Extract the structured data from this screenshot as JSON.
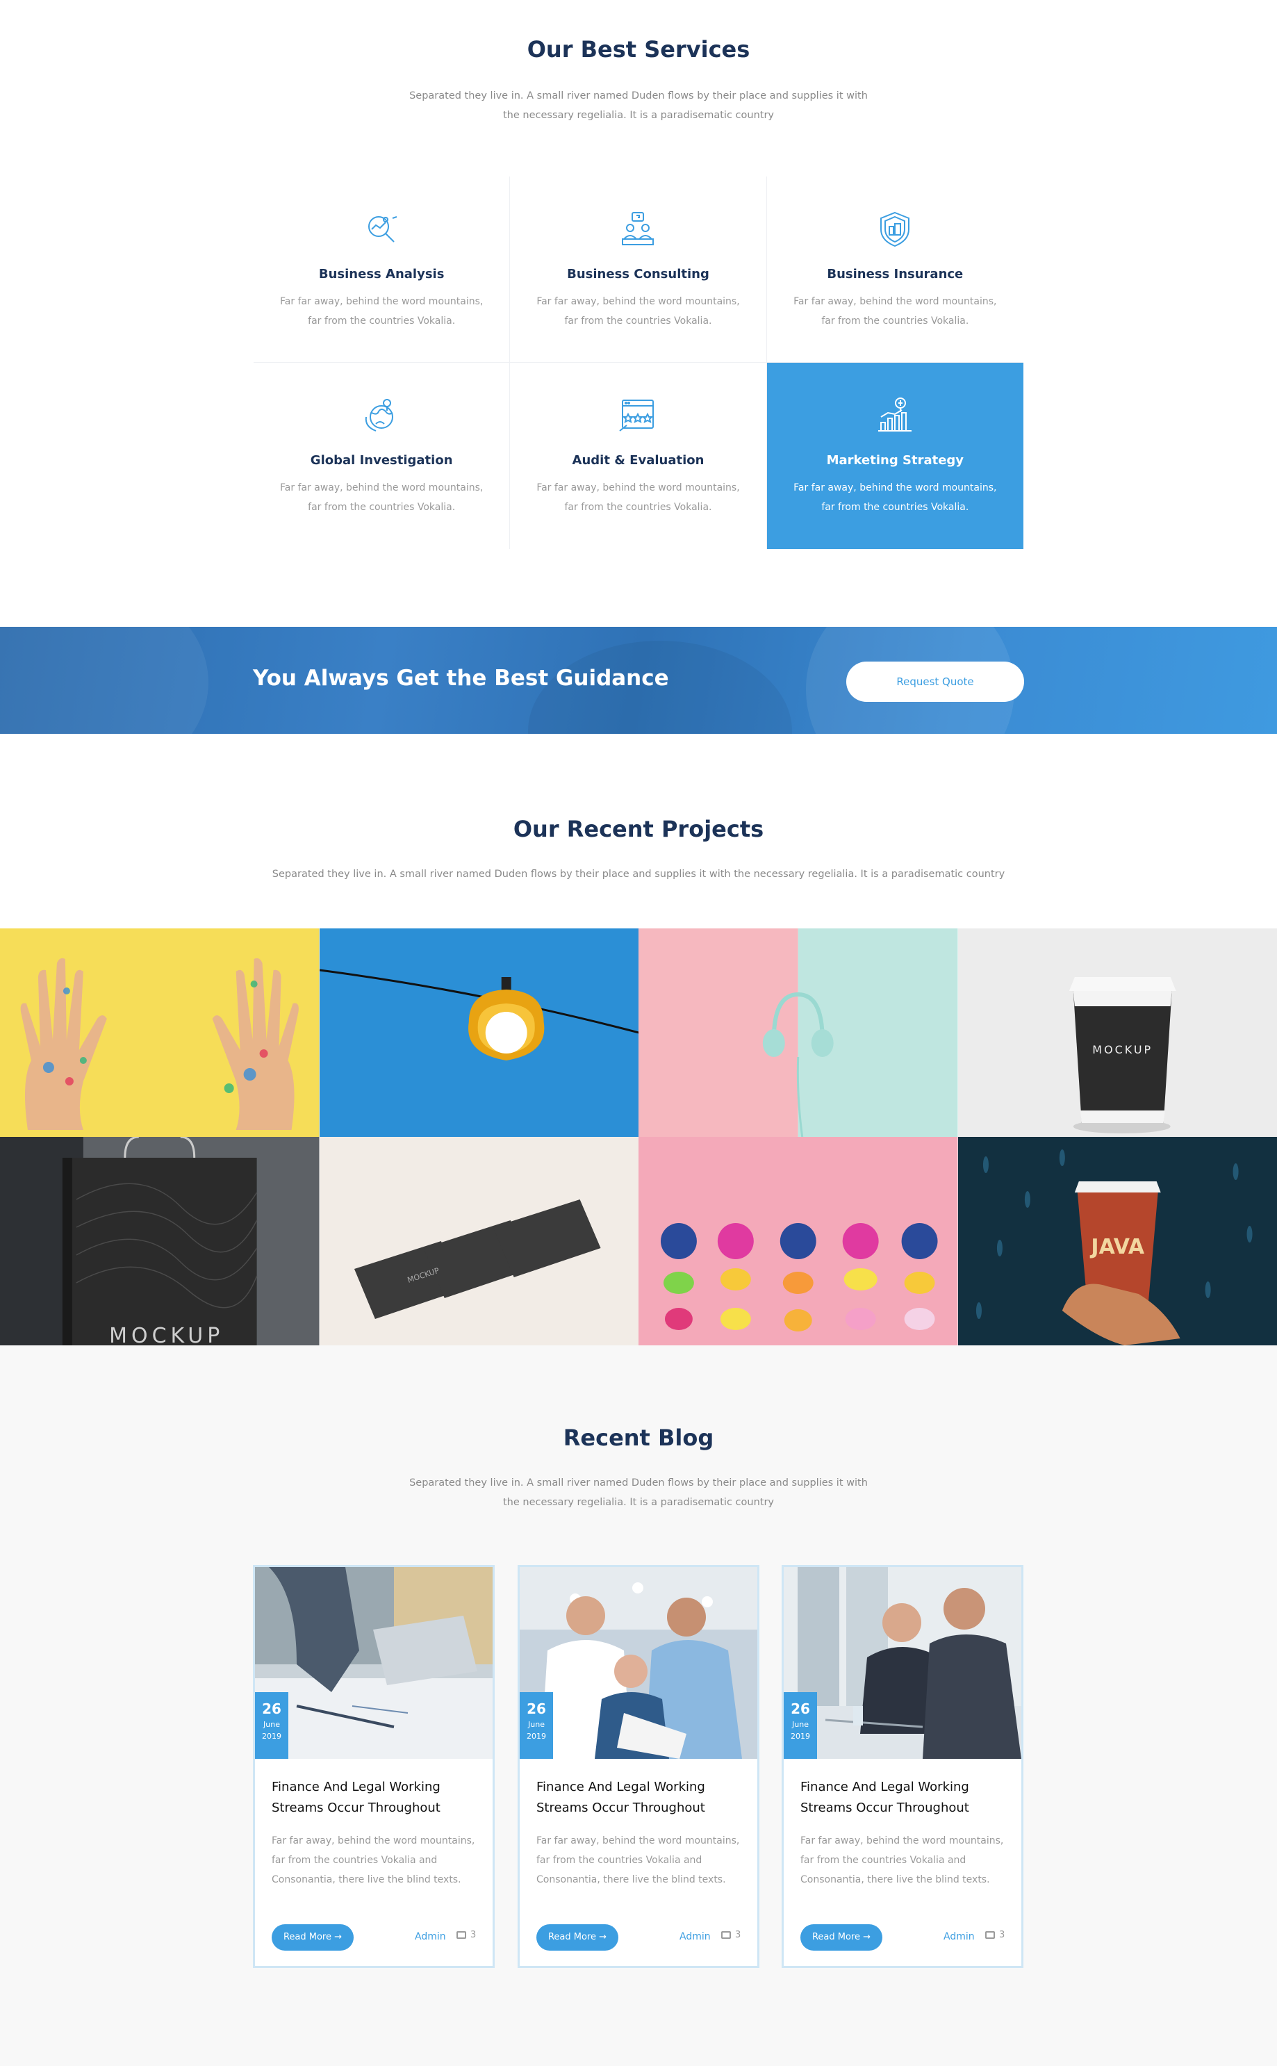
{
  "services": {
    "title": "Our Best Services",
    "subtitle": "Separated they live in. A small river named Duden flows by their place and supplies it with the necessary regelialia. It is a paradisematic country",
    "items": [
      {
        "title": "Business Analysis",
        "text": "Far far away, behind the word mountains, far from the countries Vokalia.",
        "icon": "analysis-icon"
      },
      {
        "title": "Business Consulting",
        "text": "Far far away, behind the word mountains, far from the countries Vokalia.",
        "icon": "consulting-icon"
      },
      {
        "title": "Business Insurance",
        "text": "Far far away, behind the word mountains, far from the countries Vokalia.",
        "icon": "insurance-shield-icon"
      },
      {
        "title": "Global Investigation",
        "text": "Far far away, behind the word mountains, far from the countries Vokalia.",
        "icon": "globe-icon"
      },
      {
        "title": "Audit & Evaluation",
        "text": "Far far away, behind the word mountains, far from the countries Vokalia.",
        "icon": "audit-icon"
      },
      {
        "title": "Marketing Strategy",
        "text": "Far far away, behind the word mountains, far from the countries Vokalia.",
        "icon": "strategy-chart-icon"
      }
    ]
  },
  "banner": {
    "title": "You Always Get the Best Guidance",
    "button": "Request Quote"
  },
  "projects": {
    "title": "Our Recent Projects",
    "subtitle": "Separated they live in. A small river named Duden flows by their place and supplies it with the necessary regelialia. It is a paradisematic country",
    "cup_label": "MOCKUP",
    "bag_label": "MOCKUP",
    "cards_label": "MOCKUP",
    "java_label": "JAVA"
  },
  "blog": {
    "title": "Recent Blog",
    "subtitle": "Separated they live in. A small river named Duden flows by their place and supplies it with the necessary regelialia. It is a paradisematic country",
    "posts": [
      {
        "day": "26",
        "month": "June",
        "year": "2019",
        "title": "Finance And Legal Working Streams Occur Throughout",
        "text": "Far far away, behind the word mountains, far from the countries Vokalia and Consonantia, there live the blind texts.",
        "read_more": "Read More →",
        "author": "Admin",
        "comments": "3"
      },
      {
        "day": "26",
        "month": "June",
        "year": "2019",
        "title": "Finance And Legal Working Streams Occur Throughout",
        "text": "Far far away, behind the word mountains, far from the countries Vokalia and Consonantia, there live the blind texts.",
        "read_more": "Read More →",
        "author": "Admin",
        "comments": "3"
      },
      {
        "day": "26",
        "month": "June",
        "year": "2019",
        "title": "Finance And Legal Working Streams Occur Throughout",
        "text": "Far far away, behind the word mountains, far from the countries Vokalia and Consonantia, there live the blind texts.",
        "read_more": "Read More →",
        "author": "Admin",
        "comments": "3"
      }
    ]
  },
  "colors": {
    "accent": "#3c9ee1",
    "heading": "#1c3358",
    "text": "#9a9a9a"
  }
}
